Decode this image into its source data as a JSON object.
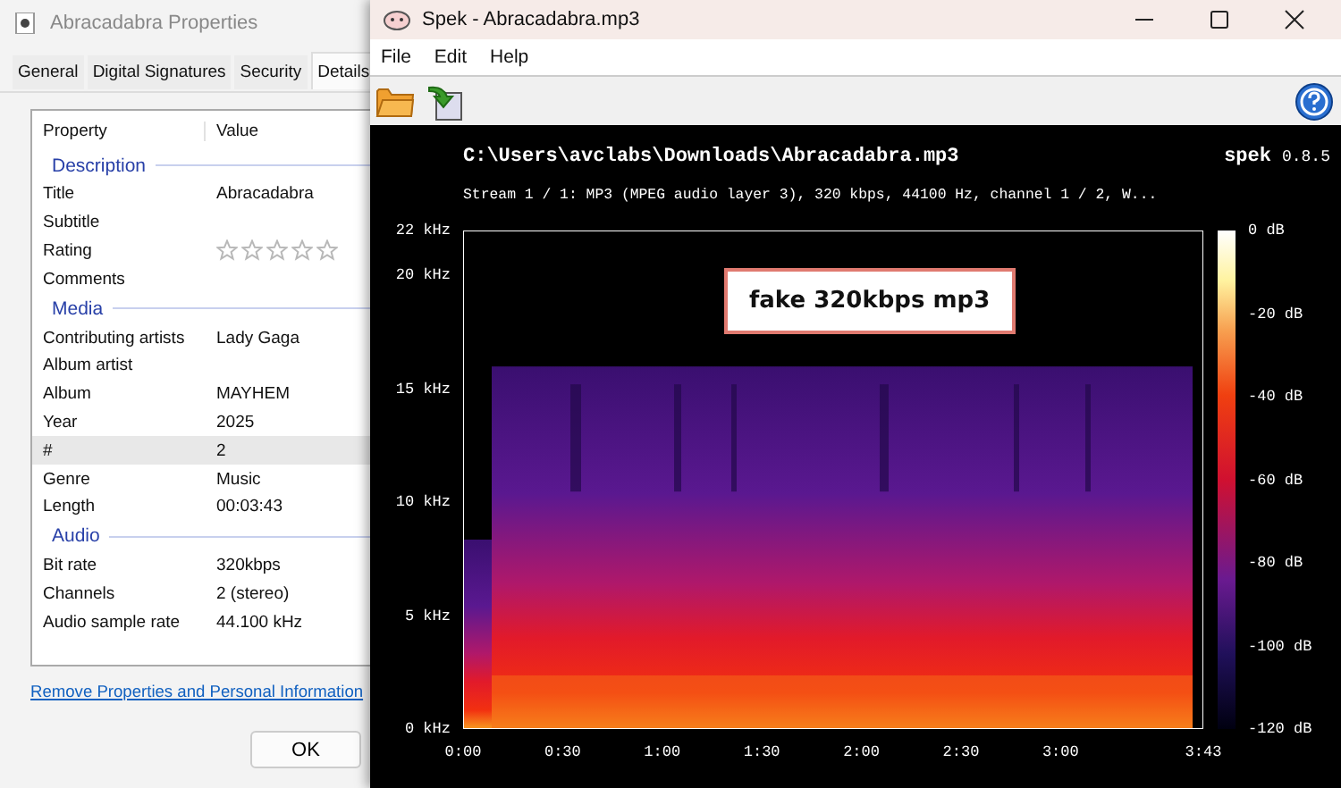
{
  "properties_window": {
    "title": "Abracadabra Properties",
    "tabs": [
      {
        "label": "General",
        "selected": false
      },
      {
        "label": "Digital Signatures",
        "selected": false
      },
      {
        "label": "Security",
        "selected": false
      },
      {
        "label": "Details",
        "selected": true
      }
    ],
    "columns": [
      "Property",
      "Value"
    ],
    "groups": [
      {
        "title": "Description",
        "rows": [
          {
            "kind": "text",
            "property": "Title",
            "value": "Abracadabra",
            "selected": false
          },
          {
            "kind": "text",
            "property": "Subtitle",
            "selected": false
          },
          {
            "kind": "rating",
            "property": "Rating",
            "stars": 0,
            "selected": false
          },
          {
            "kind": "text",
            "property": "Comments",
            "selected": false
          }
        ]
      },
      {
        "title": "Media",
        "rows": [
          {
            "kind": "text",
            "property": "Contributing artists",
            "value": "Lady Gaga",
            "selected": false
          },
          {
            "kind": "text",
            "property": "Album artist",
            "selected": false
          },
          {
            "kind": "text",
            "property": "Album",
            "value": "MAYHEM",
            "selected": false
          },
          {
            "kind": "text",
            "property": "Year",
            "value": "2025",
            "selected": false
          },
          {
            "kind": "text",
            "property": "#",
            "value": "2",
            "selected": true
          },
          {
            "kind": "text",
            "property": "Genre",
            "value": "Music",
            "selected": false
          },
          {
            "kind": "text",
            "property": "Length",
            "value": "00:03:43",
            "selected": false
          }
        ]
      },
      {
        "title": "Audio",
        "rows": [
          {
            "kind": "text",
            "property": "Bit rate",
            "value": "320kbps",
            "selected": false
          },
          {
            "kind": "text",
            "property": "Channels",
            "value": "2 (stereo)",
            "selected": false
          },
          {
            "kind": "text",
            "property": "Audio sample rate",
            "value": "44.100 kHz",
            "selected": false
          }
        ]
      }
    ],
    "link": "Remove Properties and Personal Information",
    "ok_button": "OK"
  },
  "spek_window": {
    "title": "Spek - Abracadabra.mp3",
    "menu": [
      "File",
      "Edit",
      "Help"
    ],
    "file_path": "C:\\Users\\avclabs\\Downloads\\Abracadabra.mp3",
    "app_name": "spek",
    "version": "0.8.5",
    "stream_info": "Stream 1 / 1: MP3 (MPEG audio layer 3), 320 kbps, 44100 Hz, channel 1 / 2, W...",
    "frequency_ticks": [
      "22 kHz",
      "20 kHz",
      "15 kHz",
      "10 kHz",
      "5 kHz",
      "0 kHz"
    ],
    "time_ticks": [
      "0:00",
      "0:30",
      "1:00",
      "1:30",
      "2:00",
      "2:30",
      "3:00",
      "3:43"
    ],
    "db_ticks": [
      "0 dB",
      "-20 dB",
      "-40 dB",
      "-60 dB",
      "-80 dB",
      "-100 dB",
      "-120 dB"
    ],
    "annotation": "fake 320kbps mp3"
  }
}
